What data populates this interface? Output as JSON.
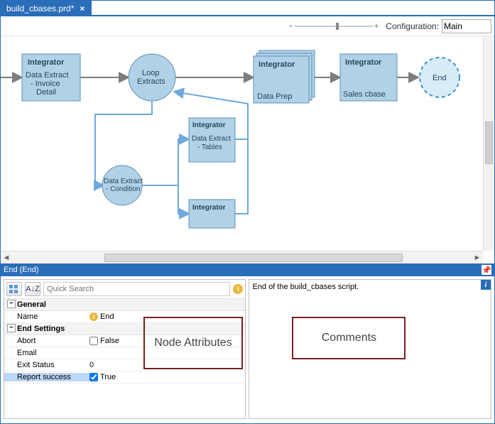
{
  "tab": {
    "title": "build_cbases.prd*",
    "close": "×"
  },
  "config": {
    "label": "Configuration:",
    "value": "Main",
    "zoom_minus": "−",
    "zoom_plus": "+"
  },
  "panel": {
    "title": "End (End)",
    "pin": "📌"
  },
  "toolbar": {
    "categorized_tooltip": "Categorized",
    "alpha_label": "A↓Z",
    "search_placeholder": "Quick Search"
  },
  "props": {
    "cat_general": "General",
    "name_label": "Name",
    "name_value": "End",
    "cat_end": "End Settings",
    "abort_label": "Abort",
    "abort_value": "False",
    "email_label": "Email",
    "email_value": "",
    "exit_label": "Exit Status",
    "exit_value": "0",
    "report_label": "Report success",
    "report_value": "True"
  },
  "comments": {
    "text": "End of the build_cbases script."
  },
  "annotations": {
    "node_attributes": "Node Attributes",
    "comments": "Comments"
  },
  "nodes": {
    "integrator": "Integrator",
    "n1": "Data Extract - Invoice Detail",
    "n2": "Loop Extracts",
    "n3": "Data Extract - Condition",
    "n4": "Data Extract - Tables",
    "n5_blank": "",
    "n6": "Data Prep",
    "n7": "Sales cbase",
    "end": "End"
  },
  "scroll": {
    "left": "◄",
    "right": "►"
  }
}
